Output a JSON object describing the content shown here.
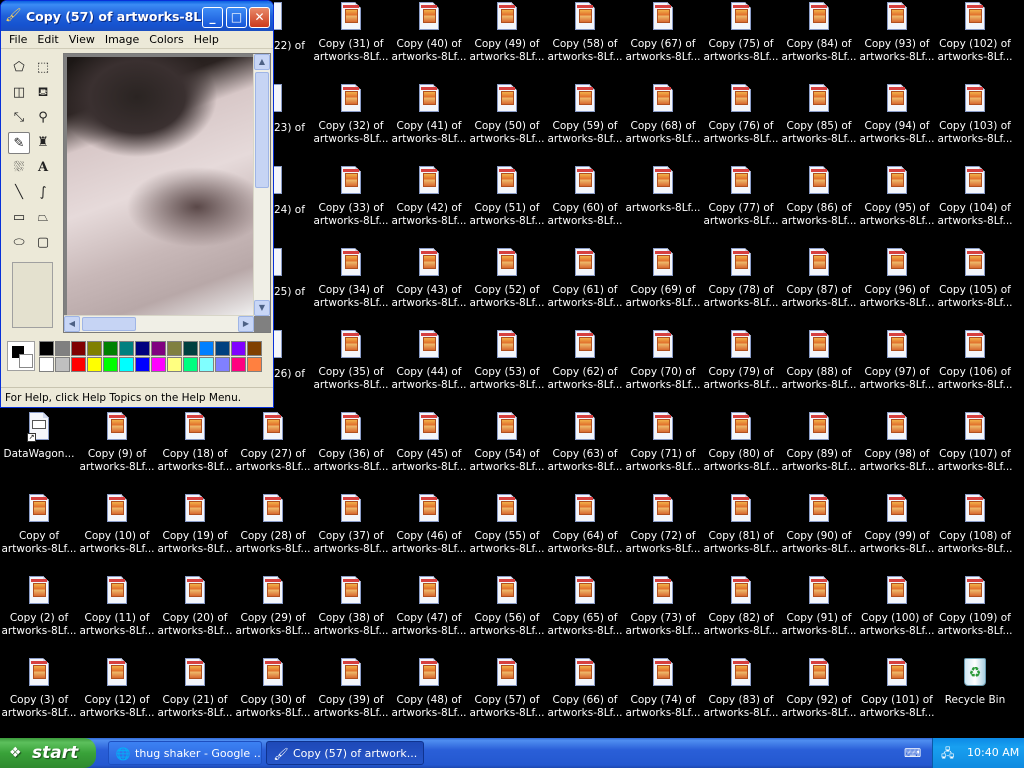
{
  "desktop": {
    "icons_rows": [
      [
        "",
        "",
        "",
        "Copy (31) of|artworks-8Lf...",
        "Copy (40) of|artworks-8Lf...",
        "Copy (49) of|artworks-8Lf...",
        "Copy (58) of|artworks-8Lf...",
        "Copy (67) of|artworks-8Lf...",
        "Copy (75) of|artworks-8Lf...",
        "Copy (84) of|artworks-8Lf...",
        "Copy (93) of|artworks-8Lf...",
        "Copy (102) of|artworks-8Lf..."
      ],
      [
        "",
        "",
        "",
        "Copy (32) of|artworks-8Lf...",
        "Copy (41) of|artworks-8Lf...",
        "Copy (50) of|artworks-8Lf...",
        "Copy (59) of|artworks-8Lf...",
        "Copy (68) of|artworks-8Lf...",
        "Copy (76) of|artworks-8Lf...",
        "Copy (85) of|artworks-8Lf...",
        "Copy (94) of|artworks-8Lf...",
        "Copy (103) of|artworks-8Lf..."
      ],
      [
        "",
        "",
        "",
        "Copy (33) of|artworks-8Lf...",
        "Copy (42) of|artworks-8Lf...",
        "Copy (51) of|artworks-8Lf...",
        "Copy (60) of|artworks-8Lf...",
        "artworks-8Lf...|",
        "Copy (77) of|artworks-8Lf...",
        "Copy (86) of|artworks-8Lf...",
        "Copy (95) of|artworks-8Lf...",
        "Copy (104) of|artworks-8Lf..."
      ],
      [
        "",
        "",
        "",
        "Copy (34) of|artworks-8Lf...",
        "Copy (43) of|artworks-8Lf...",
        "Copy (52) of|artworks-8Lf...",
        "Copy (61) of|artworks-8Lf...",
        "Copy (69) of|artworks-8Lf...",
        "Copy (78) of|artworks-8Lf...",
        "Copy (87) of|artworks-8Lf...",
        "Copy (96) of|artworks-8Lf...",
        "Copy (105) of|artworks-8Lf..."
      ],
      [
        "",
        "",
        "",
        "Copy (35) of|artworks-8Lf...",
        "Copy (44) of|artworks-8Lf...",
        "Copy (53) of|artworks-8Lf...",
        "Copy (62) of|artworks-8Lf...",
        "Copy (70) of|artworks-8Lf...",
        "Copy (79) of|artworks-8Lf...",
        "Copy (88) of|artworks-8Lf...",
        "Copy (97) of|artworks-8Lf...",
        "Copy (106) of|artworks-8Lf..."
      ],
      [
        "DataWagon...|",
        "Copy (9) of|artworks-8Lf...",
        "Copy (18) of|artworks-8Lf...",
        "Copy (27) of|artworks-8Lf...",
        "Copy (36) of|artworks-8Lf...",
        "Copy (45) of|artworks-8Lf...",
        "Copy (54) of|artworks-8Lf...",
        "Copy (63) of|artworks-8Lf...",
        "Copy (71) of|artworks-8Lf...",
        "Copy (80) of|artworks-8Lf...",
        "Copy (89) of|artworks-8Lf...",
        "Copy (98) of|artworks-8Lf...",
        "Copy (107) of|artworks-8Lf..."
      ],
      [
        "Copy of|artworks-8Lf...",
        "Copy (10) of|artworks-8Lf...",
        "Copy (19) of|artworks-8Lf...",
        "Copy (28) of|artworks-8Lf...",
        "Copy (37) of|artworks-8Lf...",
        "Copy (46) of|artworks-8Lf...",
        "Copy (55) of|artworks-8Lf...",
        "Copy (64) of|artworks-8Lf...",
        "Copy (72) of|artworks-8Lf...",
        "Copy (81) of|artworks-8Lf...",
        "Copy (90) of|artworks-8Lf...",
        "Copy (99) of|artworks-8Lf...",
        "Copy (108) of|artworks-8Lf..."
      ],
      [
        "Copy (2) of|artworks-8Lf...",
        "Copy (11) of|artworks-8Lf...",
        "Copy (20) of|artworks-8Lf...",
        "Copy (29) of|artworks-8Lf...",
        "Copy (38) of|artworks-8Lf...",
        "Copy (47) of|artworks-8Lf...",
        "Copy (56) of|artworks-8Lf...",
        "Copy (65) of|artworks-8Lf...",
        "Copy (73) of|artworks-8Lf...",
        "Copy (82) of|artworks-8Lf...",
        "Copy (91) of|artworks-8Lf...",
        "Copy (100) of|artworks-8Lf...",
        "Copy (109) of|artworks-8Lf..."
      ],
      [
        "Copy (3) of|artworks-8Lf...",
        "Copy (12) of|artworks-8Lf...",
        "Copy (21) of|artworks-8Lf...",
        "Copy (30) of|artworks-8Lf...",
        "Copy (39) of|artworks-8Lf...",
        "Copy (48) of|artworks-8Lf...",
        "Copy (57) of|artworks-8Lf...",
        "Copy (66) of|artworks-8Lf...",
        "Copy (74) of|artworks-8Lf...",
        "Copy (83) of|artworks-8Lf...",
        "Copy (92) of|artworks-8Lf...",
        "Copy (101) of|artworks-8Lf...",
        "Recycle Bin|"
      ]
    ],
    "partial_labels_rows": [
      "22) of",
      "23) of",
      "24) of",
      "25) of",
      "26) of"
    ]
  },
  "paint": {
    "title": "Copy (57) of artworks-8L...",
    "menu": [
      "File",
      "Edit",
      "View",
      "Image",
      "Colors",
      "Help"
    ],
    "tools": [
      "free-select-icon",
      "select-icon",
      "eraser-icon",
      "fill-icon",
      "color-picker-icon",
      "magnifier-icon",
      "pencil-icon",
      "brush-icon",
      "airbrush-icon",
      "text-icon",
      "line-icon",
      "curve-icon",
      "rectangle-icon",
      "polygon-icon",
      "ellipse-icon",
      "rounded-rect-icon"
    ],
    "palette_top": [
      "#000000",
      "#808080",
      "#800000",
      "#808000",
      "#008000",
      "#008080",
      "#000080",
      "#800080",
      "#808040",
      "#004040",
      "#0080ff",
      "#004080",
      "#8000ff",
      "#804000"
    ],
    "palette_bottom": [
      "#ffffff",
      "#c0c0c0",
      "#ff0000",
      "#ffff00",
      "#00ff00",
      "#00ffff",
      "#0000ff",
      "#ff00ff",
      "#ffff80",
      "#00ff80",
      "#80ffff",
      "#8080ff",
      "#ff0080",
      "#ff8040"
    ],
    "status": "For Help, click Help Topics on the Help Menu."
  },
  "taskbar": {
    "start_label": "start",
    "tasks": [
      {
        "label": "thug shaker - Google ..."
      },
      {
        "label": "Copy (57) of artwork..."
      }
    ],
    "clock": "10:40 AM"
  }
}
